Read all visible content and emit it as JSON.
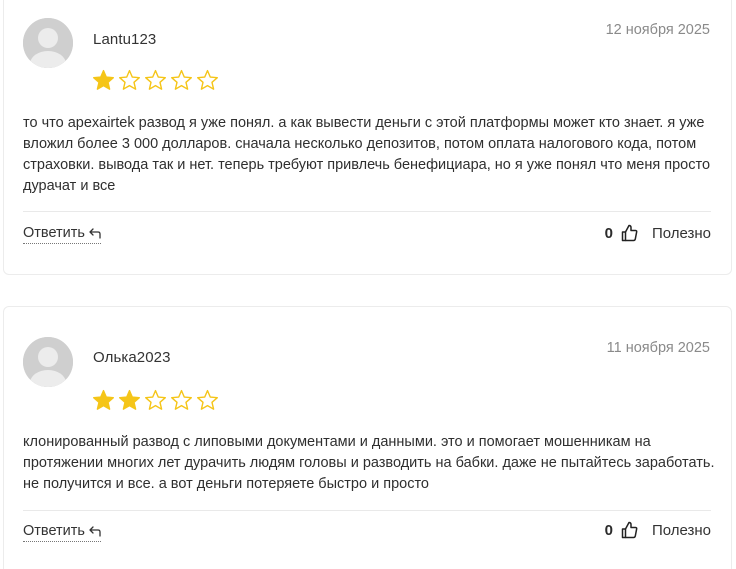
{
  "colors": {
    "star_filled": "#f5c518",
    "star_outline": "#f5c518",
    "avatar_bg": "#cfcfcf",
    "date": "#8a8a8a"
  },
  "reviews": [
    {
      "username": "Lantu123",
      "date": "12 ноября 2025",
      "rating": 1,
      "rating_max": 5,
      "text": "то что apexairtek развод я уже понял. а как вывести деньги с этой платформы может кто знает. я уже вложил более 3 000 долларов. сначала несколько депозитов, потом оплата налогового кода, потом страховки. вывода так и нет. теперь требуют привлечь бенефициара, но я уже понял что меня просто дурачат и все",
      "reply_label": "Ответить",
      "helpful_count": "0",
      "helpful_label": "Полезно"
    },
    {
      "username": "Олька2023",
      "date": "11 ноября 2025",
      "rating": 2,
      "rating_max": 5,
      "text": "клонированный развод с липовыми документами и данными. это и помогает мошенникам на протяжении многих лет дурачить людям головы и разводить на бабки. даже не пытайтесь заработать. не получится и все. а вот деньги потеряете быстро и просто",
      "reply_label": "Ответить",
      "helpful_count": "0",
      "helpful_label": "Полезно"
    }
  ],
  "icons": {
    "avatar": "user-avatar-icon",
    "star": "star-icon",
    "reply": "reply-arrow-icon",
    "helpful": "thumbs-up-icon"
  }
}
